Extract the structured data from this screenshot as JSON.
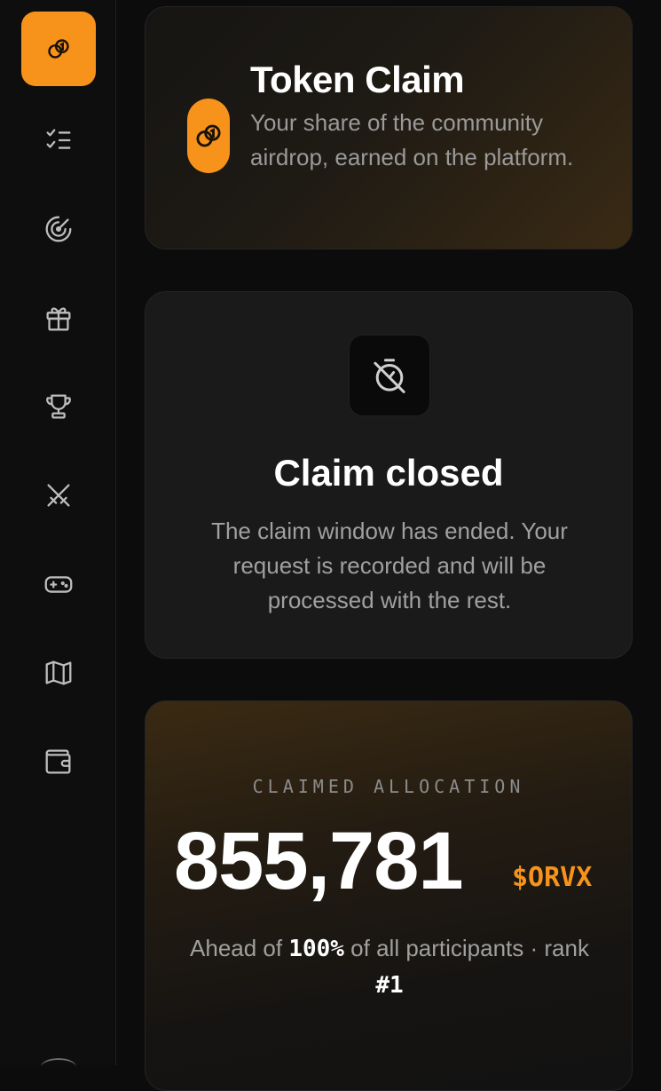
{
  "sidebar": {
    "items": [
      {
        "icon": "coins-icon",
        "active": true
      },
      {
        "icon": "checklist-icon",
        "active": false
      },
      {
        "icon": "radar-icon",
        "active": false
      },
      {
        "icon": "gift-icon",
        "active": false
      },
      {
        "icon": "trophy-icon",
        "active": false
      },
      {
        "icon": "crossed-swords-icon",
        "active": false
      },
      {
        "icon": "gamepad-icon",
        "active": false
      },
      {
        "icon": "map-icon",
        "active": false
      },
      {
        "icon": "wallet-icon",
        "active": false
      }
    ]
  },
  "header": {
    "title": "Token Claim",
    "subtitle": "Your share of the community airdrop, earned on the platform.",
    "icon": "coins-icon"
  },
  "status": {
    "icon": "timer-off-icon",
    "title": "Claim closed",
    "description": "The claim window has ended. Your request is recorded and will be processed with the rest."
  },
  "allocation": {
    "label": "CLAIMED ALLOCATION",
    "amount": "855,781",
    "unit": "$ORVX",
    "rank_prefix": "Ahead of ",
    "percentile": "100%",
    "rank_middle": " of all participants · rank ",
    "rank": "#1"
  },
  "colors": {
    "accent": "#f7931a",
    "background": "#0c0c0c",
    "card": "#1a1a1a",
    "muted_text": "#9a9a9a"
  }
}
